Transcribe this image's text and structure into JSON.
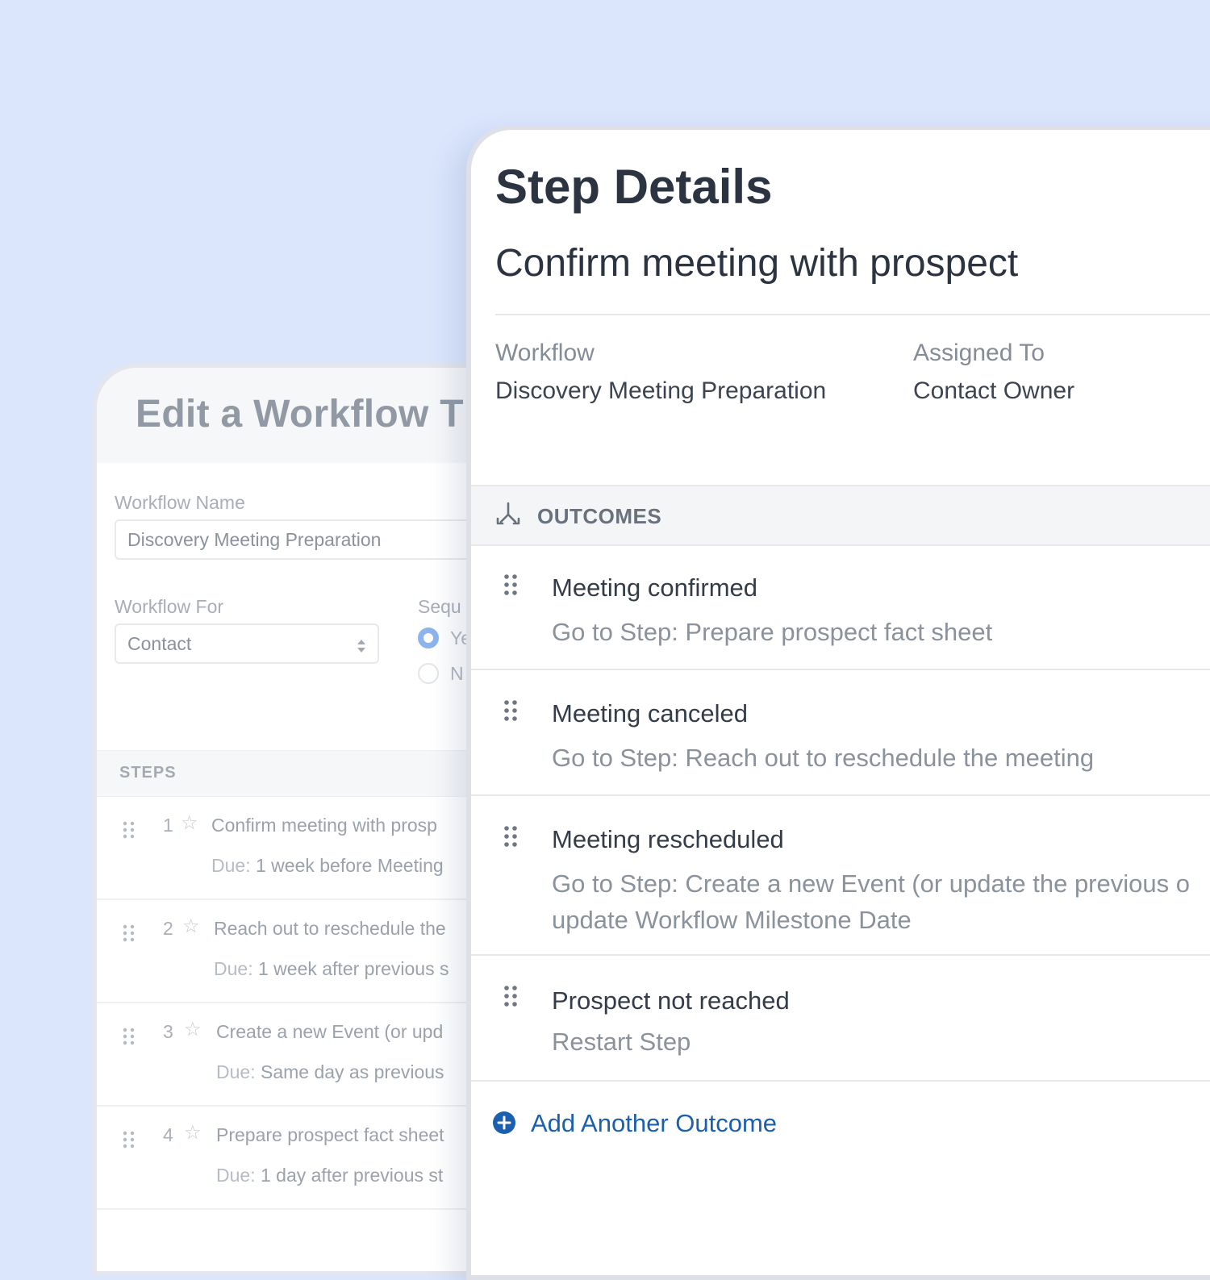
{
  "back_panel": {
    "title": "Edit a Workflow T",
    "workflow_name_label": "Workflow Name",
    "workflow_name_value": "Discovery Meeting Preparation",
    "workflow_for_label": "Workflow For",
    "workflow_for_value": "Contact",
    "sequential_label": "Sequ",
    "radio_yes": "Ye",
    "radio_no": "N",
    "steps_label": "STEPS",
    "due_label": "Due:",
    "steps": [
      {
        "number": "1",
        "title": "Confirm meeting with prosp",
        "due": "1 week before Meeting"
      },
      {
        "number": "2",
        "title": "Reach out to reschedule the",
        "due": "1 week after previous s"
      },
      {
        "number": "3",
        "title": "Create a new Event (or upd",
        "due": "Same day as previous"
      },
      {
        "number": "4",
        "title": "Prepare prospect fact sheet",
        "due": "1 day after previous st"
      }
    ]
  },
  "step_details": {
    "title": "Step Details",
    "step_name": "Confirm meeting with prospect",
    "workflow_label": "Workflow",
    "workflow_value": "Discovery Meeting Preparation",
    "assigned_label": "Assigned To",
    "assigned_value": "Contact Owner",
    "outcomes_label": "OUTCOMES",
    "outcomes": [
      {
        "title": "Meeting confirmed",
        "desc": "Go to Step: Prepare prospect fact sheet",
        "desc2": ""
      },
      {
        "title": "Meeting canceled",
        "desc": "Go to Step: Reach out to reschedule the meeting",
        "desc2": ""
      },
      {
        "title": "Meeting rescheduled",
        "desc": "Go to Step: Create a new Event (or update the previous o",
        "desc2": "update Workflow Milestone Date"
      },
      {
        "title": "Prospect not reached",
        "desc": "Restart Step",
        "desc2": ""
      }
    ],
    "add_outcome_label": "Add Another Outcome"
  },
  "colors": {
    "background": "#dbe6fd",
    "accent_blue": "#1b5fae",
    "radio_selected": "#8db4ec"
  },
  "icons": {
    "outcomes": "branch-arrows-icon",
    "drag": "drag-handle-icon",
    "star": "star-outline-icon",
    "add": "plus-circle-icon",
    "select": "select-arrows-icon"
  }
}
